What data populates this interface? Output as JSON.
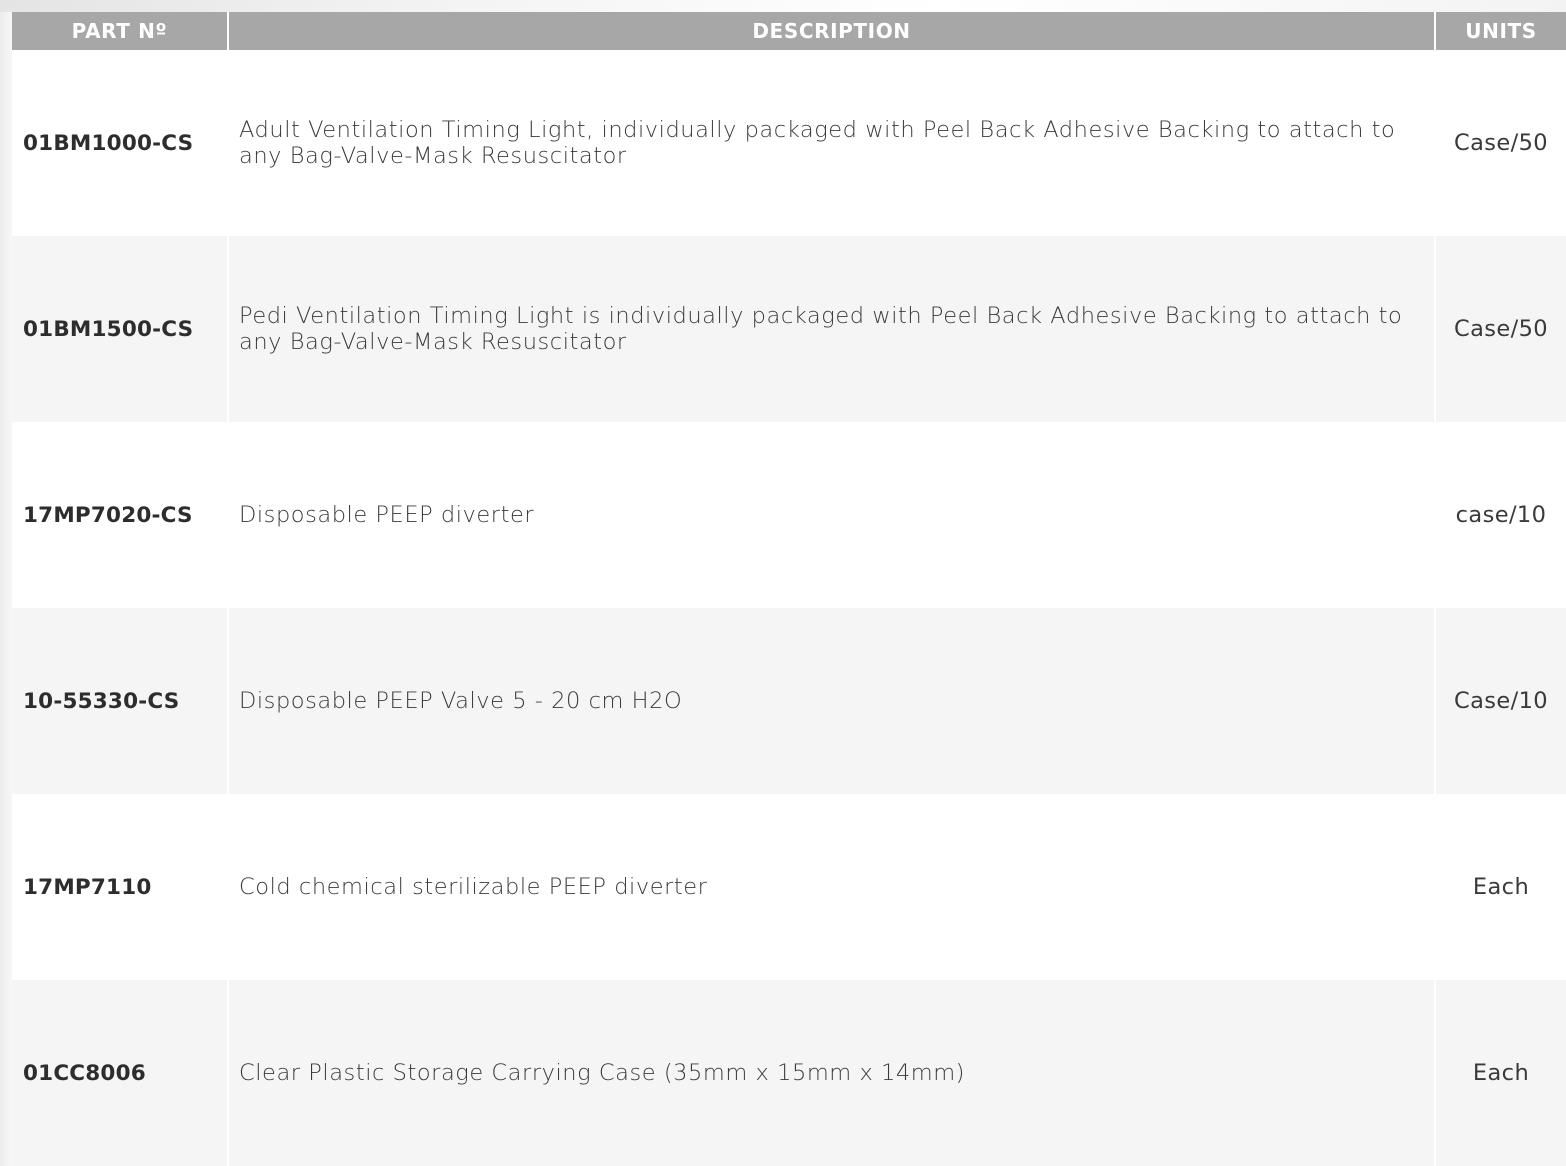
{
  "table": {
    "headers": {
      "part": "PART Nº",
      "description": "DESCRIPTION",
      "units": "UNITS"
    },
    "rows": [
      {
        "part": "01BM1000-CS",
        "description": "Adult Ventilation Timing Light, individually packaged with Peel Back Adhesive Backing to attach to any Bag-Valve-Mask Resuscitator",
        "units": "Case/50"
      },
      {
        "part": "01BM1500-CS",
        "description": "Pedi Ventilation Timing Light is individually packaged with Peel Back Adhesive Backing to attach to any Bag-Valve-Mask Resuscitator",
        "units": "Case/50"
      },
      {
        "part": "17MP7020-CS",
        "description": "Disposable PEEP diverter",
        "units": "case/10"
      },
      {
        "part": "10-55330-CS",
        "description": "Disposable PEEP Valve 5 - 20 cm H2O",
        "units": "Case/10"
      },
      {
        "part": "17MP7110",
        "description": "Cold chemical sterilizable PEEP diverter",
        "units": "Each"
      },
      {
        "part": "01CC8006",
        "description": "Clear Plastic Storage Carrying Case (35mm x 15mm x 14mm)",
        "units": "Each"
      }
    ]
  },
  "colors": {
    "header_bg": "#a7a7a7",
    "header_text": "#ffffff",
    "alt_row_bg": "#f5f5f5",
    "text": "#3a3a3a"
  }
}
